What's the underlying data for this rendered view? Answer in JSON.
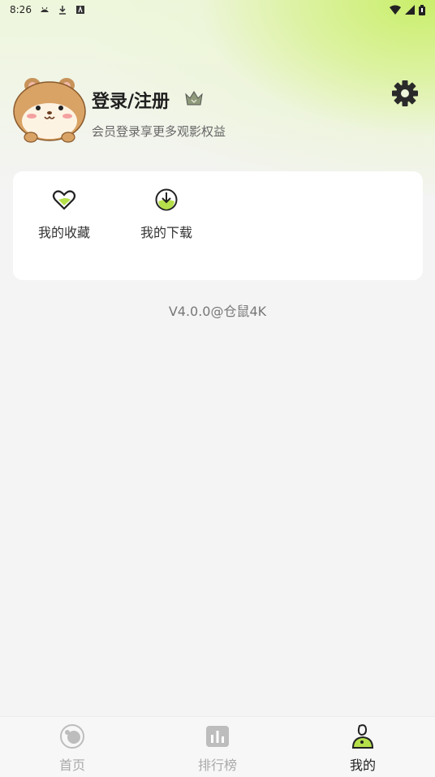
{
  "status_bar": {
    "time": "8:26",
    "left_icons": [
      "android-debug-icon",
      "download-icon",
      "a-box-icon"
    ],
    "right_icons": [
      "wifi-icon",
      "signal-icon",
      "battery-icon"
    ]
  },
  "profile": {
    "avatar_icon": "hamster-avatar-icon",
    "login_label": "登录/注册",
    "crown_icon": "vip-crown-icon",
    "subtitle": "会员登录享更多观影权益",
    "settings_icon": "gear-icon"
  },
  "shortcuts": {
    "favorites_label": "我的收藏",
    "downloads_label": "我的下载"
  },
  "version": "V4.0.0@仓鼠4K",
  "bottom_nav": {
    "items": [
      {
        "label": "首页",
        "icon": "home-icon",
        "active": false
      },
      {
        "label": "排行榜",
        "icon": "ranking-icon",
        "active": false
      },
      {
        "label": "我的",
        "icon": "profile-icon",
        "active": true
      }
    ]
  },
  "colors": {
    "accent_green": "#b6e04a",
    "background": "#f4f4f4",
    "card": "#ffffff",
    "inactive_tab": "#aaaaaa"
  }
}
